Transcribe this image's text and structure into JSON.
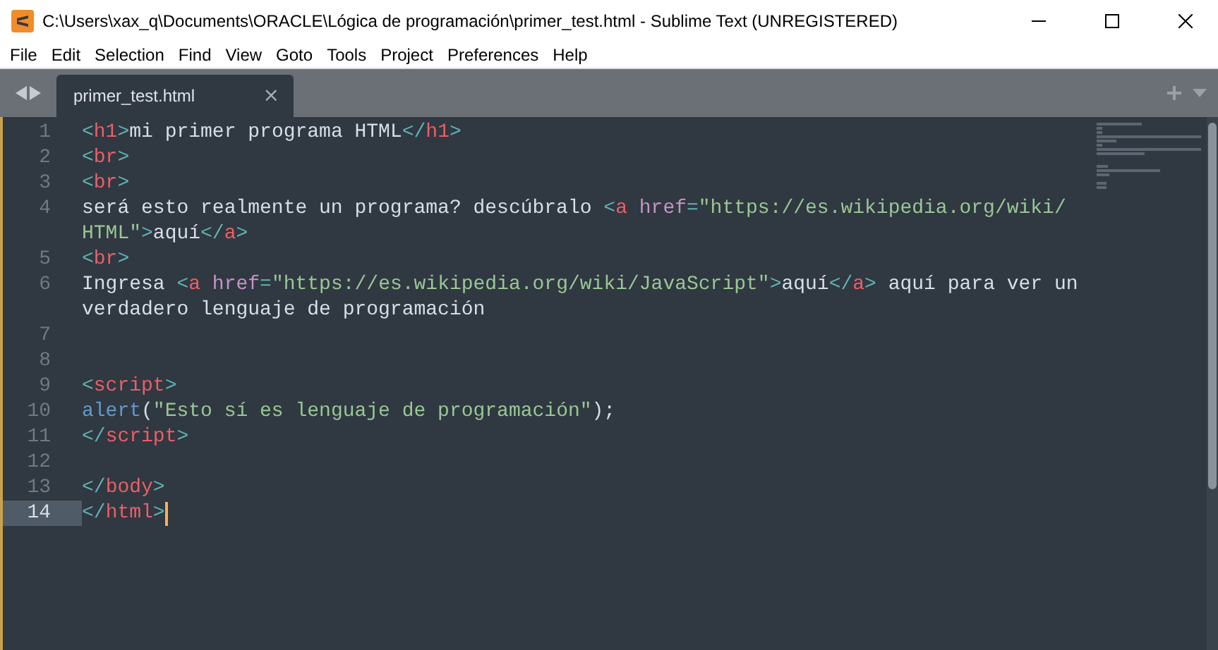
{
  "window": {
    "title": "C:\\Users\\xax_q\\Documents\\ORACLE\\Lógica de programación\\primer_test.html - Sublime Text (UNREGISTERED)"
  },
  "menu": [
    "File",
    "Edit",
    "Selection",
    "Find",
    "View",
    "Goto",
    "Tools",
    "Project",
    "Preferences",
    "Help"
  ],
  "tabs": [
    {
      "label": "primer_test.html",
      "selected": true,
      "close": "×"
    }
  ],
  "editor": {
    "lines": [
      {
        "number": "1",
        "current": false,
        "rows": [
          {
            "tokens": [
              {
                "kind": "punct",
                "t": "<"
              },
              {
                "kind": "tag",
                "t": "h1"
              },
              {
                "kind": "punct",
                "t": ">"
              },
              {
                "kind": "text",
                "t": "mi primer programa HTML"
              },
              {
                "kind": "punct",
                "t": "</"
              },
              {
                "kind": "tag",
                "t": "h1"
              },
              {
                "kind": "punct",
                "t": ">"
              }
            ]
          }
        ]
      },
      {
        "number": "2",
        "current": false,
        "rows": [
          {
            "tokens": [
              {
                "kind": "punct",
                "t": "<"
              },
              {
                "kind": "tag",
                "t": "br"
              },
              {
                "kind": "punct",
                "t": ">"
              }
            ]
          }
        ]
      },
      {
        "number": "3",
        "current": false,
        "rows": [
          {
            "tokens": [
              {
                "kind": "punct",
                "t": "<"
              },
              {
                "kind": "tag",
                "t": "br"
              },
              {
                "kind": "punct",
                "t": ">"
              }
            ]
          }
        ]
      },
      {
        "number": "4",
        "current": false,
        "rows": [
          {
            "tokens": [
              {
                "kind": "text",
                "t": "será esto realmente un programa? descúbralo "
              },
              {
                "kind": "punct",
                "t": "<"
              },
              {
                "kind": "tag",
                "t": "a"
              },
              {
                "kind": "attr",
                "t": " href"
              },
              {
                "kind": "punct",
                "t": "="
              },
              {
                "kind": "string",
                "t": "\"https://es.wikipedia.org/wiki/"
              }
            ]
          },
          {
            "tokens": [
              {
                "kind": "string",
                "t": "HTML\""
              },
              {
                "kind": "punct",
                "t": ">"
              },
              {
                "kind": "text",
                "t": "aquí"
              },
              {
                "kind": "punct",
                "t": "</"
              },
              {
                "kind": "tag",
                "t": "a"
              },
              {
                "kind": "punct",
                "t": ">"
              }
            ]
          }
        ]
      },
      {
        "number": "5",
        "current": false,
        "rows": [
          {
            "tokens": [
              {
                "kind": "punct",
                "t": "<"
              },
              {
                "kind": "tag",
                "t": "br"
              },
              {
                "kind": "punct",
                "t": ">"
              }
            ]
          }
        ]
      },
      {
        "number": "6",
        "current": false,
        "rows": [
          {
            "tokens": [
              {
                "kind": "text",
                "t": "Ingresa "
              },
              {
                "kind": "punct",
                "t": "<"
              },
              {
                "kind": "tag",
                "t": "a"
              },
              {
                "kind": "attr",
                "t": " href"
              },
              {
                "kind": "punct",
                "t": "="
              },
              {
                "kind": "string",
                "t": "\"https://es.wikipedia.org/wiki/JavaScript\""
              },
              {
                "kind": "punct",
                "t": ">"
              },
              {
                "kind": "text",
                "t": "aquí"
              },
              {
                "kind": "punct",
                "t": "</"
              },
              {
                "kind": "tag",
                "t": "a"
              },
              {
                "kind": "punct",
                "t": ">"
              },
              {
                "kind": "text",
                "t": " aquí para ver un"
              }
            ]
          },
          {
            "tokens": [
              {
                "kind": "text",
                "t": "verdadero lenguaje de programación"
              }
            ]
          }
        ]
      },
      {
        "number": "7",
        "current": false,
        "rows": [
          {
            "tokens": []
          }
        ]
      },
      {
        "number": "8",
        "current": false,
        "rows": [
          {
            "tokens": []
          }
        ]
      },
      {
        "number": "9",
        "current": false,
        "rows": [
          {
            "tokens": [
              {
                "kind": "punct",
                "t": "<"
              },
              {
                "kind": "tag",
                "t": "script"
              },
              {
                "kind": "punct",
                "t": ">"
              }
            ]
          }
        ]
      },
      {
        "number": "10",
        "current": false,
        "rows": [
          {
            "tokens": [
              {
                "kind": "func",
                "t": "alert"
              },
              {
                "kind": "text",
                "t": "("
              },
              {
                "kind": "string",
                "t": "\"Esto sí es lenguaje de programación\""
              },
              {
                "kind": "text",
                "t": ");"
              }
            ]
          }
        ]
      },
      {
        "number": "11",
        "current": false,
        "rows": [
          {
            "tokens": [
              {
                "kind": "punct",
                "t": "</"
              },
              {
                "kind": "tag",
                "t": "script"
              },
              {
                "kind": "punct",
                "t": ">"
              }
            ]
          }
        ]
      },
      {
        "number": "12",
        "current": false,
        "rows": [
          {
            "tokens": []
          }
        ]
      },
      {
        "number": "13",
        "current": false,
        "rows": [
          {
            "tokens": [
              {
                "kind": "punct",
                "t": "</"
              },
              {
                "kind": "tag",
                "t": "body"
              },
              {
                "kind": "punct",
                "t": ">"
              }
            ]
          }
        ]
      },
      {
        "number": "14",
        "current": true,
        "rows": [
          {
            "tokens": [
              {
                "kind": "punct",
                "t": "</"
              },
              {
                "kind": "tag",
                "t": "html"
              },
              {
                "kind": "punct",
                "t": ">"
              }
            ]
          }
        ]
      }
    ]
  }
}
